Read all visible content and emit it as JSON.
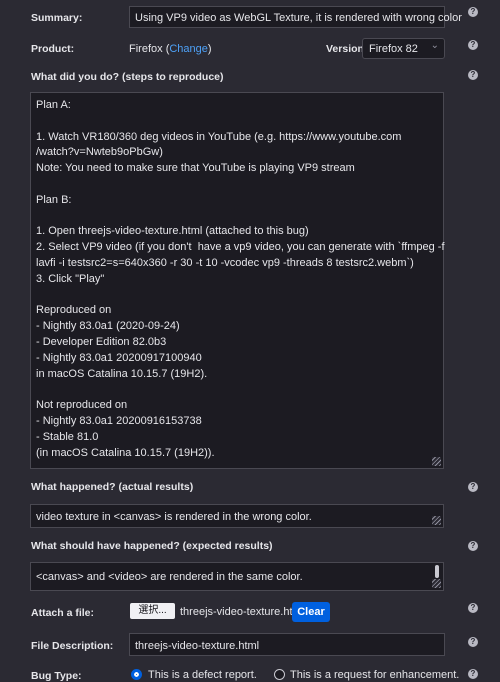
{
  "summary": {
    "label": "Summary:",
    "value": "Using VP9 video as WebGL Texture, it is rendered with wrong color"
  },
  "product": {
    "label": "Product:",
    "value": "Firefox",
    "change_open": "(",
    "change_link": "Change",
    "change_close": ")"
  },
  "version": {
    "label": "Version:",
    "value": "Firefox 82"
  },
  "steps": {
    "label": "What did you do? (steps to reproduce)",
    "lines": [
      "Plan A:",
      "",
      "1. Watch VR180/360 deg videos in YouTube (e.g. https://www.youtube.com",
      "/watch?v=Nwteb9oPbGw)",
      "Note: You need to make sure that YouTube is playing VP9 stream",
      "",
      "Plan B:",
      "",
      "1. Open threejs-video-texture.html (attached to this bug)",
      "2. Select VP9 video (if you don't  have a vp9 video, you can generate with `ffmpeg -f",
      "lavfi -i testsrc2=s=640x360 -r 30 -t 10 -vcodec vp9 -threads 8 testsrc2.webm`)",
      "3. Click \"Play\"",
      "",
      "Reproduced on",
      "- Nightly 83.0a1 (2020-09-24)",
      "- Developer Edition 82.0b3",
      "- Nightly 83.0a1 20200917100940",
      "in macOS Catalina 10.15.7 (19H2).",
      "",
      "Not reproduced on",
      "- Nightly 83.0a1 20200916153738",
      "- Stable 81.0",
      "(in macOS Catalina 10.15.7 (19H2))."
    ]
  },
  "actual": {
    "label": "What happened? (actual results)",
    "value": "video texture in <canvas> is rendered in the wrong color."
  },
  "expected": {
    "label": "What should have happened? (expected results)",
    "value": "<canvas> and <video> are rendered in the same color."
  },
  "attach": {
    "label": "Attach a file:",
    "browse": "選択...",
    "filename": "threejs-video-texture.html",
    "clear": "Clear"
  },
  "description": {
    "label": "File Description:",
    "value": "threejs-video-texture.html"
  },
  "bug_type": {
    "label": "Bug Type:",
    "option_defect": "This is a defect report.",
    "option_enhancement": "This is a request for enhancement."
  },
  "help_glyph": "?",
  "colors": {
    "accent": "#0060df",
    "link": "#4ea1f7",
    "background": "#2b2a33"
  }
}
